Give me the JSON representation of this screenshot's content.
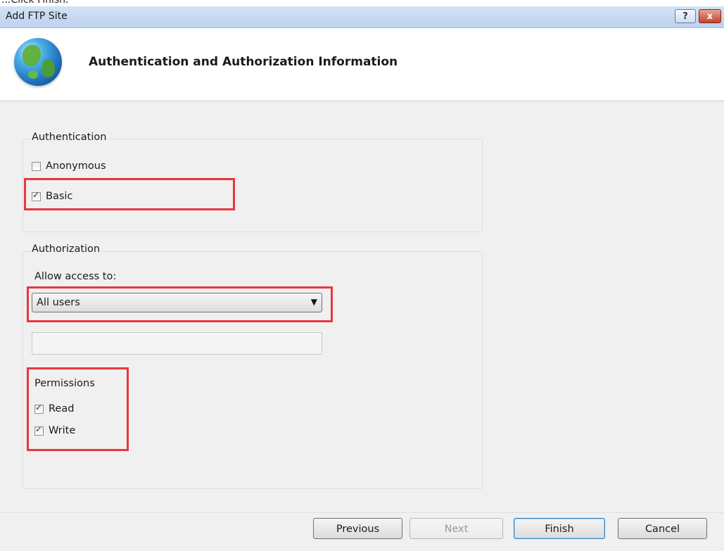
{
  "caption": "...Click Finish.",
  "window": {
    "title": "Add FTP Site",
    "help_glyph": "?",
    "close_glyph": "x"
  },
  "header": {
    "heading": "Authentication and Authorization Information",
    "icon": "globe-icon"
  },
  "authentication": {
    "legend": "Authentication",
    "anonymous": {
      "label": "Anonymous",
      "checked": false
    },
    "basic": {
      "label": "Basic",
      "checked": true
    }
  },
  "authorization": {
    "legend": "Authorization",
    "allow_label": "Allow access to:",
    "selected": "All users",
    "names_value": "",
    "permissions": {
      "label": "Permissions",
      "read": {
        "label": "Read",
        "checked": true
      },
      "write": {
        "label": "Write",
        "checked": true
      }
    }
  },
  "buttons": {
    "previous": "Previous",
    "next": "Next",
    "finish": "Finish",
    "cancel": "Cancel"
  },
  "colors": {
    "highlight": "#e8373f",
    "titlebar": "#c9dbf2",
    "dialog_bg": "#f0f0f0"
  }
}
